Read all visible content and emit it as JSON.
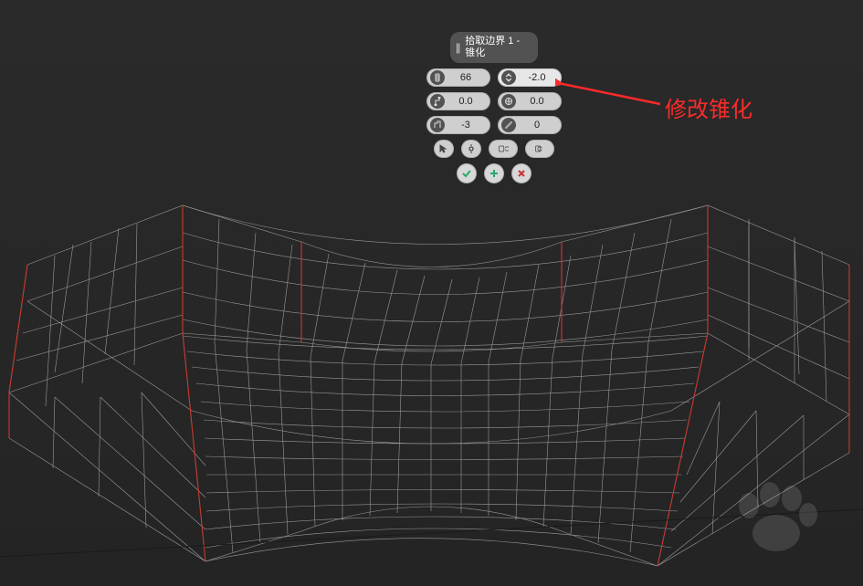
{
  "panel": {
    "title": "拾取边界 1 - 锥化",
    "segments": "66",
    "taper": "-2.0",
    "twist": "0.0",
    "gravity": "0.0",
    "offset": "-3",
    "steps": "0"
  },
  "annotation": {
    "text": "修改锥化"
  }
}
